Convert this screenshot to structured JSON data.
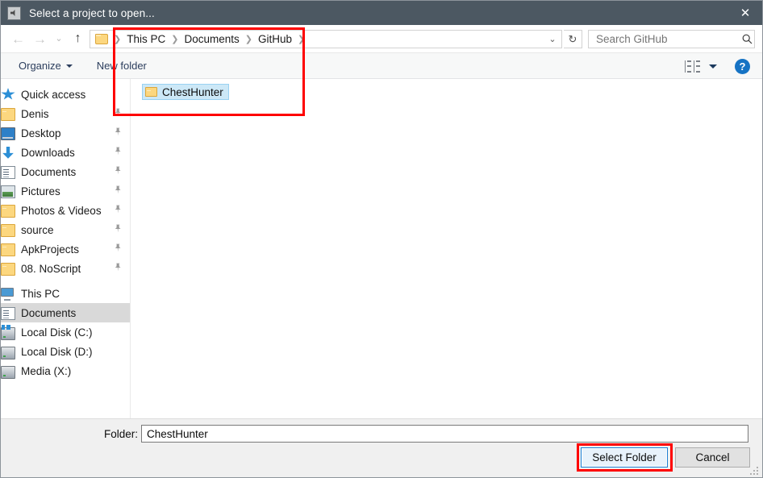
{
  "window": {
    "title": "Select a project to open...",
    "app_icon": "app-icon",
    "close_label": "✕"
  },
  "nav": {
    "back_icon": "←",
    "forward_icon": "→",
    "recent_icon": "⌄",
    "up_icon": "↑"
  },
  "address": {
    "folder_icon": "folder-icon",
    "separator": "❯",
    "crumbs": [
      "This PC",
      "Documents",
      "GitHub"
    ],
    "dropdown_icon": "⌄",
    "refresh_icon": "↻"
  },
  "search": {
    "placeholder": "Search GitHub",
    "value": "",
    "icon": "🔍"
  },
  "toolbar": {
    "organize_label": "Organize",
    "new_folder_label": "New folder",
    "view_icon": "view-mode-icon",
    "help_label": "?"
  },
  "sidebar": {
    "groups": [
      {
        "name": "quick-access",
        "header": {
          "label": "Quick access",
          "icon": "star-icon",
          "pinned": false
        },
        "items": [
          {
            "label": "Denis",
            "icon": "folder-icon",
            "pinned": true
          },
          {
            "label": "Desktop",
            "icon": "desktop-icon",
            "pinned": true
          },
          {
            "label": "Downloads",
            "icon": "download-icon",
            "pinned": true
          },
          {
            "label": "Documents",
            "icon": "document-icon",
            "pinned": true
          },
          {
            "label": "Pictures",
            "icon": "picture-icon",
            "pinned": true
          },
          {
            "label": "Photos & Videos",
            "icon": "folder-icon",
            "pinned": true
          },
          {
            "label": "source",
            "icon": "folder-icon",
            "pinned": true
          },
          {
            "label": "ApkProjects",
            "icon": "folder-icon",
            "pinned": true
          },
          {
            "label": "08. NoScript",
            "icon": "folder-icon",
            "pinned": true
          }
        ]
      },
      {
        "name": "this-pc",
        "header": {
          "label": "This PC",
          "icon": "computer-icon",
          "pinned": false
        },
        "items": [
          {
            "label": "Documents",
            "icon": "document-icon",
            "pinned": false,
            "selected": true
          },
          {
            "label": "Local Disk (C:)",
            "icon": "system-drive-icon",
            "pinned": false
          },
          {
            "label": "Local Disk (D:)",
            "icon": "drive-icon",
            "pinned": false
          },
          {
            "label": "Media (X:)",
            "icon": "drive-icon",
            "pinned": false
          }
        ]
      }
    ],
    "pin_glyph": "📌"
  },
  "file_pane": {
    "items": [
      {
        "name": "ChestHunter",
        "icon": "folder-icon",
        "selected": true
      }
    ]
  },
  "footer": {
    "folder_label": "Folder:",
    "folder_value": "ChestHunter",
    "select_button": "Select Folder",
    "cancel_button": "Cancel"
  },
  "annotations": {
    "accent_color": "#fe0000",
    "boxes": [
      "breadcrumb-path-area",
      "select-folder-button"
    ]
  },
  "colors": {
    "titlebar": "#4c5862",
    "selection_fill": "#cce8f7",
    "selection_border": "#99d1f2",
    "sidebar_selected": "#d9d9d9",
    "toolbar_text": "#2c3e5d",
    "accent_blue": "#1673c4",
    "annotation_red": "#fe0000"
  }
}
